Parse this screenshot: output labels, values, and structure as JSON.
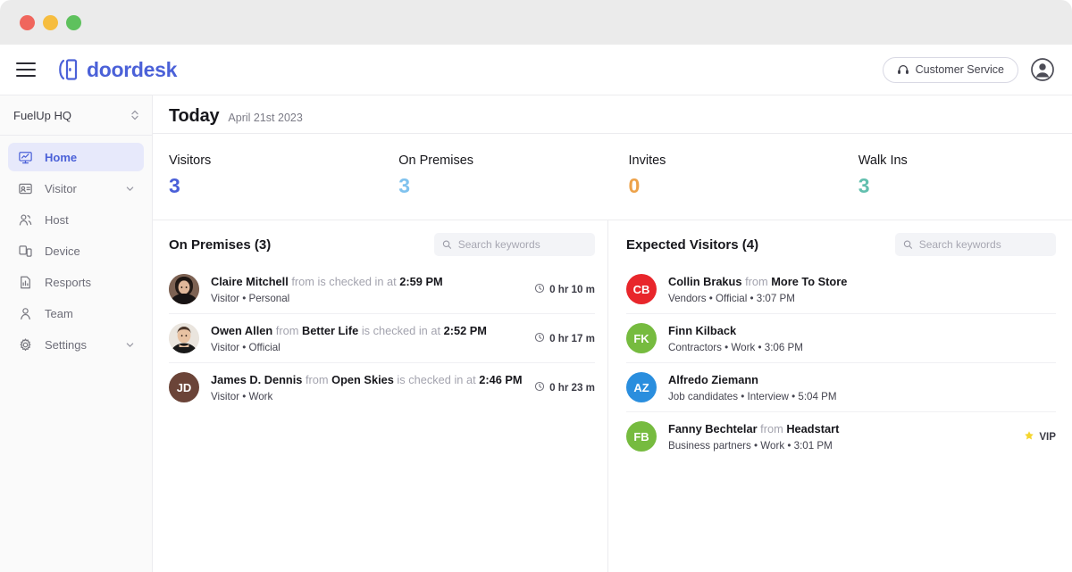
{
  "window": {
    "controls": [
      {
        "name": "close",
        "color": "#f0665d"
      },
      {
        "name": "minimize",
        "color": "#f6bd3f"
      },
      {
        "name": "maximize",
        "color": "#5ec15d"
      }
    ]
  },
  "header": {
    "menu_icon": "hamburger-icon",
    "brand": "doordesk",
    "brand_color": "#4b61d8",
    "customer_service_label": "Customer Service",
    "customer_service_icon": "headset-icon",
    "account_icon": "user-avatar-icon"
  },
  "sidebar": {
    "org": "FuelUp HQ",
    "org_chevron_icon": "chevron-up-down-icon",
    "items": [
      {
        "label": "Home",
        "icon": "dashboard-monitor-icon",
        "active": true,
        "chevron": false
      },
      {
        "label": "Visitor",
        "icon": "id-card-icon",
        "active": false,
        "chevron": true
      },
      {
        "label": "Host",
        "icon": "users-icon",
        "active": false,
        "chevron": false
      },
      {
        "label": "Device",
        "icon": "devices-icon",
        "active": false,
        "chevron": false
      },
      {
        "label": "Resports",
        "icon": "report-document-icon",
        "active": false,
        "chevron": false
      },
      {
        "label": "Team",
        "icon": "person-icon",
        "active": false,
        "chevron": false
      },
      {
        "label": "Settings",
        "icon": "gear-icon",
        "active": false,
        "chevron": true
      }
    ],
    "active_bg": "#e7e9fb",
    "active_color": "#4b61d8"
  },
  "page": {
    "title": "Today",
    "date": "April 21st 2023"
  },
  "stats": [
    {
      "label": "Visitors",
      "value": "3",
      "color": "#4a5fd8"
    },
    {
      "label": "On Premises",
      "value": "3",
      "color": "#7fc2ee"
    },
    {
      "label": "Invites",
      "value": "0",
      "color": "#eda košt"
    },
    {
      "label": "Walk Ins",
      "value": "3",
      "color": "#62bfae"
    }
  ],
  "on_premises": {
    "title": "On Premises (3)",
    "search_placeholder": "Search keywords",
    "search_value": "",
    "search_icon": "search-icon",
    "rows": [
      {
        "avatar_type": "photo",
        "avatar_variant": "claire",
        "initials": "",
        "avatar_bg": "#6b4a3c",
        "name": "Claire Mitchell",
        "from_word": "from",
        "org": "",
        "mid": "is checked in at",
        "time": "2:59 PM",
        "meta": "Visitor • Personal",
        "duration": "0 hr 10 m",
        "duration_icon": "clock-icon"
      },
      {
        "avatar_type": "photo",
        "avatar_variant": "owen",
        "initials": "",
        "avatar_bg": "#e9e4df",
        "name": "Owen Allen",
        "from_word": "from",
        "org": "Better Life",
        "mid": "is checked in at",
        "time": "2:52 PM",
        "meta": "Visitor • Official",
        "duration": "0 hr 17 m",
        "duration_icon": "clock-icon"
      },
      {
        "avatar_type": "initials",
        "avatar_variant": "",
        "initials": "JD",
        "avatar_bg": "#6b4438",
        "name": "James D. Dennis",
        "from_word": "from",
        "org": "Open Skies",
        "mid": "is checked in at",
        "time": "2:46 PM",
        "meta": "Visitor • Work",
        "duration": "0 hr 23 m",
        "duration_icon": "clock-icon"
      }
    ]
  },
  "expected_visitors": {
    "title": "Expected Visitors (4)",
    "search_placeholder": "Search keywords",
    "search_value": "",
    "search_icon": "search-icon",
    "rows": [
      {
        "initials": "CB",
        "avatar_bg": "#e8262b",
        "name": "Collin Brakus",
        "from_word": "from",
        "org": "More To Store",
        "meta": "Vendors • Official • 3:07 PM",
        "vip": false,
        "vip_label": "",
        "vip_icon": ""
      },
      {
        "initials": "FK",
        "avatar_bg": "#76bb3f",
        "name": "Finn Kilback",
        "from_word": "",
        "org": "",
        "meta": "Contractors • Work • 3:06 PM",
        "vip": false,
        "vip_label": "",
        "vip_icon": ""
      },
      {
        "initials": "AZ",
        "avatar_bg": "#2a8ede",
        "name": "Alfredo Ziemann",
        "from_word": "",
        "org": "",
        "meta": "Job candidates • Interview • 5:04 PM",
        "vip": false,
        "vip_label": "",
        "vip_icon": ""
      },
      {
        "initials": "FB",
        "avatar_bg": "#76bb3f",
        "name": "Fanny Bechtelar",
        "from_word": "from",
        "org": "Headstart",
        "meta": "Business partners • Work • 3:01 PM",
        "vip": true,
        "vip_label": "VIP",
        "vip_icon": "star-icon"
      }
    ]
  }
}
